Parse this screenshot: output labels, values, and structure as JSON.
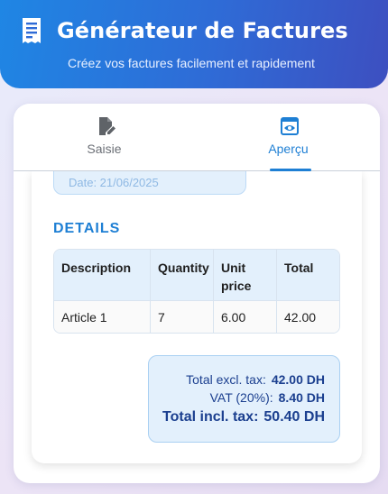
{
  "header": {
    "title": "Générateur de Factures",
    "subtitle": "Créez vos factures facilement et rapidement",
    "icon": "invoice-icon"
  },
  "tabs": [
    {
      "label": "Saisie",
      "icon": "edit-document-icon",
      "active": false
    },
    {
      "label": "Aperçu",
      "icon": "preview-eye-icon",
      "active": true
    }
  ],
  "invoice": {
    "date_text": "Date:  21/06/2025",
    "section_title": "DETAILS",
    "table": {
      "headers": [
        "Description",
        "Quantity",
        "Unit price",
        "Total"
      ],
      "rows": [
        [
          "Article 1",
          "7",
          "6.00",
          "42.00"
        ]
      ]
    },
    "totals": {
      "excl_label": "Total excl. tax:",
      "excl_value": "42.00 DH",
      "vat_label": "VAT (20%):",
      "vat_value": "8.40 DH",
      "incl_label": "Total incl. tax:",
      "incl_value": "50.40 DH"
    }
  },
  "colors": {
    "accent": "#1e7fd4",
    "header_start": "#1f86e4",
    "header_end": "#3d4fc0",
    "totals_text": "#1b3f8f"
  }
}
